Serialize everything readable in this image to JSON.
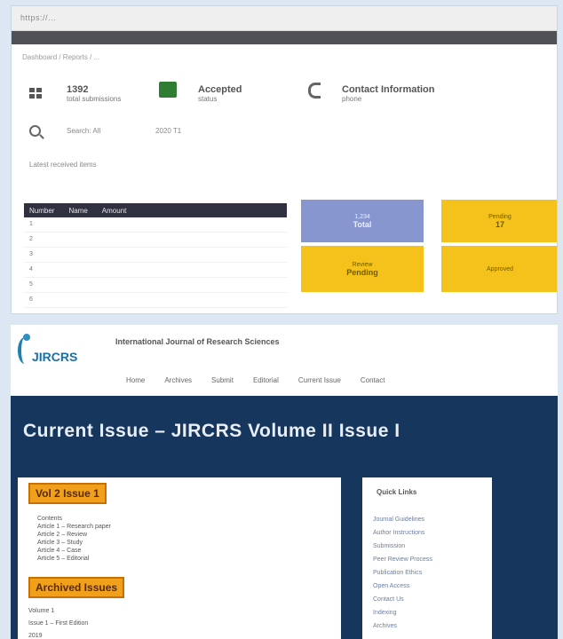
{
  "top_panel": {
    "url": "https://...",
    "breadcrumb": "Dashboard / Reports / ...",
    "stats": [
      {
        "big": "1392",
        "small": "total submissions"
      },
      {
        "big": "Accepted",
        "small": "status"
      },
      {
        "big": "Contact Information",
        "small": "phone"
      }
    ],
    "search_label": "Search: All",
    "search_value": "2020 T1",
    "sub_line": "Latest received items",
    "table": {
      "headers": [
        "Number",
        "Name",
        "Amount"
      ],
      "rows": [
        "1",
        "2",
        "3",
        "4",
        "5",
        "6"
      ]
    },
    "tiles": [
      {
        "label": "1,234",
        "value": "Total"
      },
      {
        "label": "Pending",
        "value": "17"
      },
      {
        "label": "Review",
        "value": "Pending"
      },
      {
        "label": "Approved",
        "value": ""
      }
    ]
  },
  "bottom_panel": {
    "logo_text": "JIRCRS",
    "site_name": "International Journal of Research Sciences",
    "nav": [
      "Home",
      "Archives",
      "Submit",
      "Editorial",
      "Current Issue",
      "Contact"
    ],
    "hero_title": "Current Issue – JIRCRS Volume II Issue I",
    "badges": [
      "Vol 2 Issue 1",
      "Archived Issues"
    ],
    "card_lines": [
      "Contents",
      "Article 1 – Research paper",
      "Article 2 – Review",
      "Article 3 – Study",
      "Article 4 – Case",
      "Article 5 – Editorial"
    ],
    "card_lines2": [
      "Volume 1",
      "Issue 1 – First Edition",
      "2019"
    ],
    "side_title": "Quick Links",
    "side_links": [
      "Journal Guidelines",
      "Author Instructions",
      "Submission",
      "Peer Review Process",
      "Publication Ethics",
      "Open Access",
      "Contact Us",
      "Indexing",
      "Archives"
    ]
  }
}
